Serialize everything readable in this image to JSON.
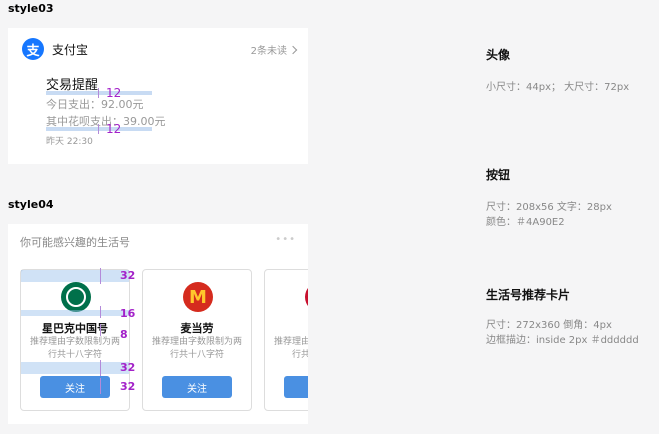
{
  "style03": {
    "tag": "style03",
    "app_name": "支付宝",
    "logo_char": "支",
    "unread": "2条未读",
    "title": "交易提醒",
    "today_spend": "今日支出：92.00元",
    "huabei_spend": "其中花呗支出：39.00元",
    "time": "昨天 22:30",
    "measure_top": "12",
    "measure_bottom": "12"
  },
  "style04": {
    "tag": "style04",
    "title": "你可能感兴趣的生活号",
    "more": "•••",
    "cards": [
      {
        "name": "星巴克中国号",
        "desc": "推荐理由字数限制为两行共十八字符",
        "button": "关注",
        "logo_icon": "starbucks-logo"
      },
      {
        "name": "麦当劳",
        "desc": "推荐理由字数限制为两行共十八字符",
        "button": "关注",
        "logo_icon": "mcdonalds-logo",
        "logo_text": "M"
      },
      {
        "name": "招",
        "desc": "推荐理由字数限制为两行共十八字符",
        "button": "关注",
        "logo_icon": "bank-logo"
      }
    ],
    "measures": [
      "32",
      "16",
      "8",
      "32",
      "32"
    ]
  },
  "spec": {
    "avatar_title": "头像",
    "avatar_text": "小尺寸：44px；  大尺寸：72px",
    "button_title": "按钮",
    "button_line1": "尺寸：208x56   文字：28px",
    "button_line2": "颜色：＃4A90E2",
    "card_title": "生活号推荐卡片",
    "card_line1": "尺寸：272x360  倒角：4px",
    "card_line2": "边框描边：inside 2px  ＃dddddd"
  },
  "colors": {
    "button": "#4A90E2",
    "border": "#dddddd",
    "alipay": "#1677ff"
  }
}
